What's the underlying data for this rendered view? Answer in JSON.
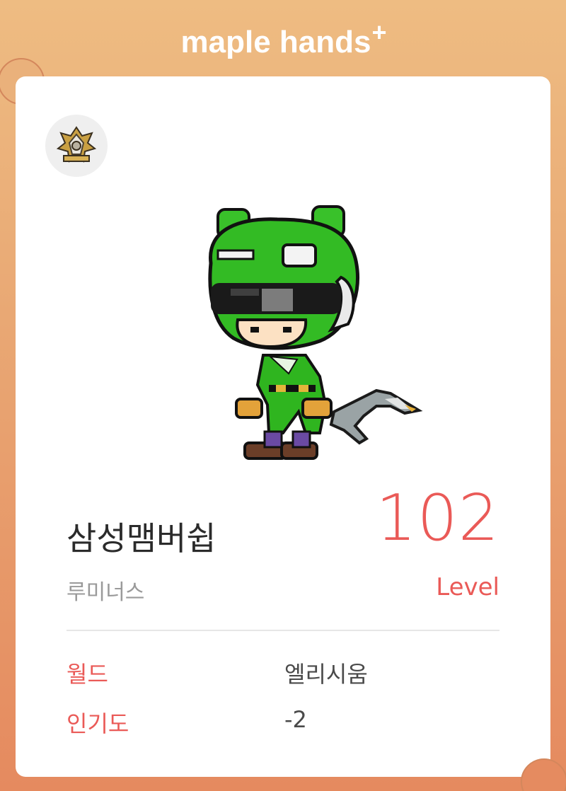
{
  "brand": {
    "logo_text": "maple hands",
    "logo_suffix": "+",
    "icon": "maple-hands-logo"
  },
  "emblem": {
    "icon": "guild-emblem-icon"
  },
  "character": {
    "icon": "character-avatar-green-bear-suit",
    "name": "삼성맴버쉽",
    "job": "루미너스",
    "level": "102",
    "level_label": "Level"
  },
  "info": [
    {
      "label": "월드",
      "value": "엘리시움"
    },
    {
      "label": "인기도",
      "value": "-2"
    }
  ],
  "colors": {
    "accent": "#ea5a57",
    "frame_top": "#eebc82",
    "frame_bottom": "#e58a5f",
    "card": "#ffffff"
  }
}
